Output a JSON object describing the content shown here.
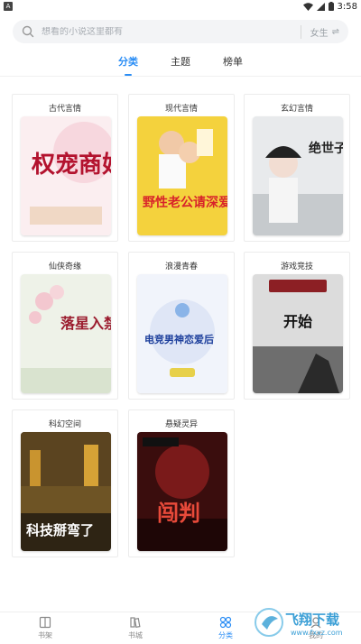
{
  "status_bar": {
    "time": "3:58",
    "app_badge": "A"
  },
  "search": {
    "placeholder": "想看的小说这里都有",
    "gender_label": "女生",
    "swap_symbol": "⇌"
  },
  "tabs": [
    {
      "label": "分类",
      "active": true
    },
    {
      "label": "主题",
      "active": false
    },
    {
      "label": "榜单",
      "active": false
    }
  ],
  "categories": [
    {
      "label": "古代言情",
      "cover_text": "权宠商妃"
    },
    {
      "label": "现代言情",
      "cover_text": "野性老公请深爱!"
    },
    {
      "label": "玄幻言情",
      "cover_text": "绝世子妃"
    },
    {
      "label": "仙侠奇缘",
      "cover_text": "落星入禁"
    },
    {
      "label": "浪漫青春",
      "cover_text": "电竞男神恋爱后"
    },
    {
      "label": "游戏竞技",
      "cover_text": "开始"
    },
    {
      "label": "科幻空间",
      "cover_text": "科技掰弯了"
    },
    {
      "label": "悬疑灵异",
      "cover_text": "闯判"
    }
  ],
  "bottom_nav": [
    {
      "label": "书架",
      "icon": "book-icon",
      "active": false
    },
    {
      "label": "书城",
      "icon": "store-icon",
      "active": false
    },
    {
      "label": "分类",
      "icon": "category-icon",
      "active": true
    },
    {
      "label": "我的",
      "icon": "profile-icon",
      "active": false
    }
  ],
  "watermark": {
    "text": "飞翔下载",
    "url": "www.fxxz.com"
  },
  "colors": {
    "accent": "#2a8df5",
    "card_border": "#ececec",
    "search_bg": "#f3f4f6"
  }
}
